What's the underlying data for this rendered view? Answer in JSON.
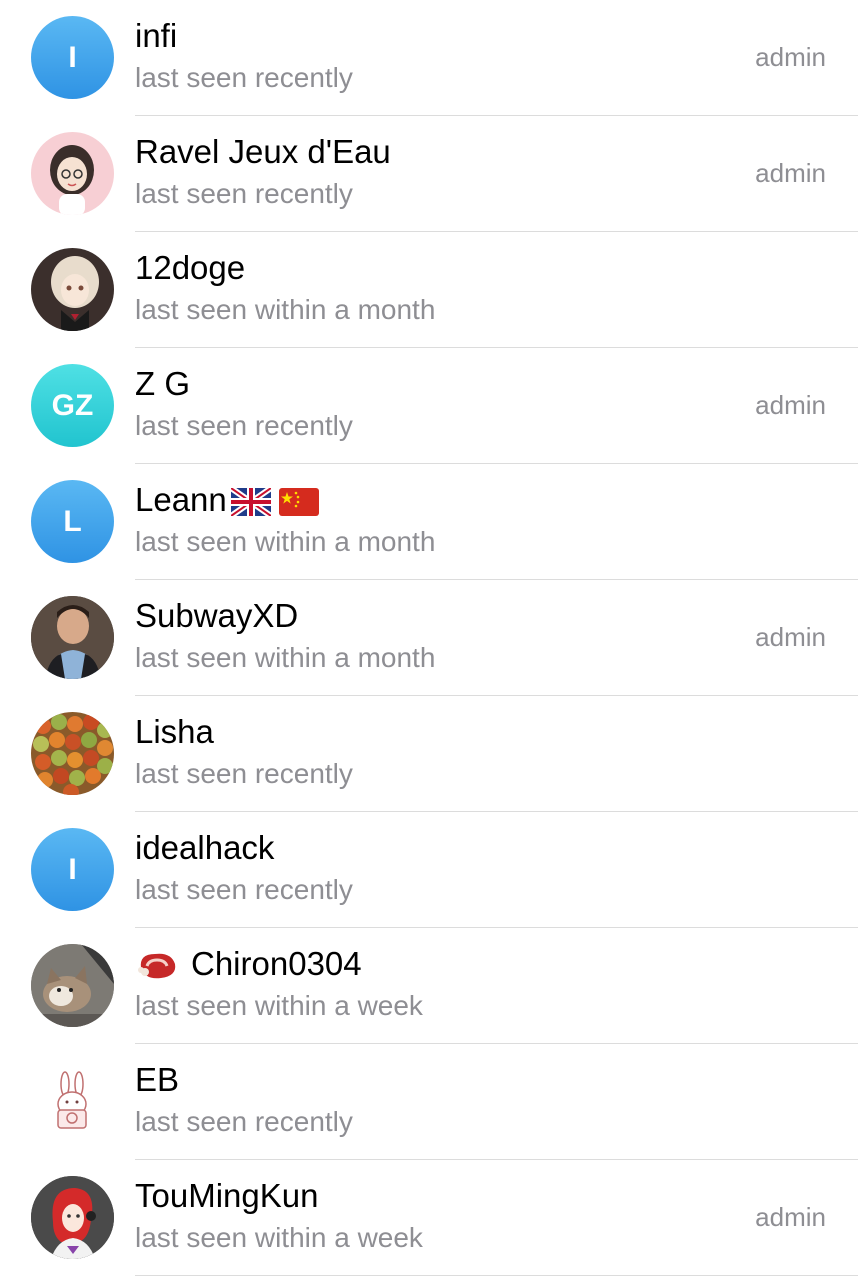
{
  "members": [
    {
      "name": "infi",
      "status": "last seen recently",
      "role": "admin",
      "initials": "I"
    },
    {
      "name": "Ravel Jeux d'Eau",
      "status": "last seen recently",
      "role": "admin"
    },
    {
      "name": "12doge",
      "status": "last seen within a month",
      "role": ""
    },
    {
      "name": "Z G",
      "status": "last seen recently",
      "role": "admin",
      "initials": "GZ"
    },
    {
      "name": "Leann",
      "status": "last seen within a month",
      "role": "",
      "initials": "L"
    },
    {
      "name": "SubwayXD",
      "status": "last seen within a month",
      "role": "admin"
    },
    {
      "name": "Lisha",
      "status": "last seen recently",
      "role": ""
    },
    {
      "name": "idealhack",
      "status": "last seen recently",
      "role": "",
      "initials": "I"
    },
    {
      "name": "Chiron0304",
      "status": "last seen within a week",
      "role": ""
    },
    {
      "name": "EB",
      "status": "last seen recently",
      "role": ""
    },
    {
      "name": "TouMingKun",
      "status": "last seen within a week",
      "role": "admin"
    }
  ],
  "colors": {
    "avatar_blue": "#3d9fe8",
    "avatar_cyan": "#2ccfd6",
    "secondary_text": "#8e8e93"
  }
}
